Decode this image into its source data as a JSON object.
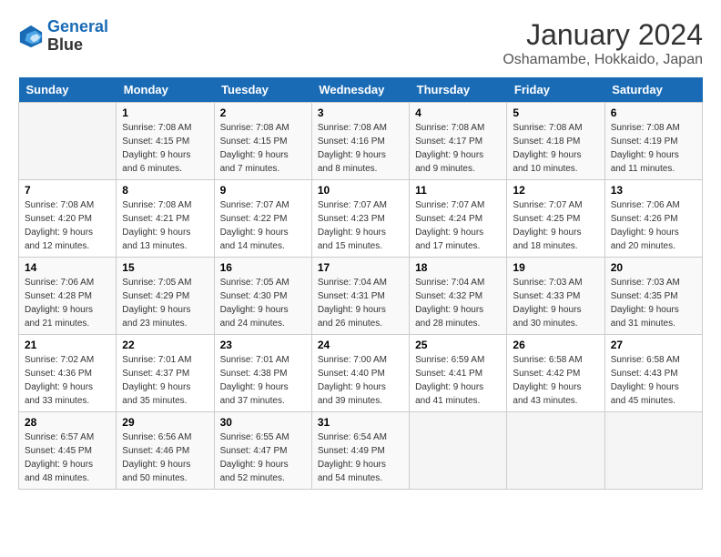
{
  "header": {
    "logo_line1": "General",
    "logo_line2": "Blue",
    "title": "January 2024",
    "subtitle": "Oshamambe, Hokkaido, Japan"
  },
  "days_of_week": [
    "Sunday",
    "Monday",
    "Tuesday",
    "Wednesday",
    "Thursday",
    "Friday",
    "Saturday"
  ],
  "weeks": [
    [
      {
        "num": "",
        "detail": ""
      },
      {
        "num": "1",
        "detail": "Sunrise: 7:08 AM\nSunset: 4:15 PM\nDaylight: 9 hours\nand 6 minutes."
      },
      {
        "num": "2",
        "detail": "Sunrise: 7:08 AM\nSunset: 4:15 PM\nDaylight: 9 hours\nand 7 minutes."
      },
      {
        "num": "3",
        "detail": "Sunrise: 7:08 AM\nSunset: 4:16 PM\nDaylight: 9 hours\nand 8 minutes."
      },
      {
        "num": "4",
        "detail": "Sunrise: 7:08 AM\nSunset: 4:17 PM\nDaylight: 9 hours\nand 9 minutes."
      },
      {
        "num": "5",
        "detail": "Sunrise: 7:08 AM\nSunset: 4:18 PM\nDaylight: 9 hours\nand 10 minutes."
      },
      {
        "num": "6",
        "detail": "Sunrise: 7:08 AM\nSunset: 4:19 PM\nDaylight: 9 hours\nand 11 minutes."
      }
    ],
    [
      {
        "num": "7",
        "detail": "Sunrise: 7:08 AM\nSunset: 4:20 PM\nDaylight: 9 hours\nand 12 minutes."
      },
      {
        "num": "8",
        "detail": "Sunrise: 7:08 AM\nSunset: 4:21 PM\nDaylight: 9 hours\nand 13 minutes."
      },
      {
        "num": "9",
        "detail": "Sunrise: 7:07 AM\nSunset: 4:22 PM\nDaylight: 9 hours\nand 14 minutes."
      },
      {
        "num": "10",
        "detail": "Sunrise: 7:07 AM\nSunset: 4:23 PM\nDaylight: 9 hours\nand 15 minutes."
      },
      {
        "num": "11",
        "detail": "Sunrise: 7:07 AM\nSunset: 4:24 PM\nDaylight: 9 hours\nand 17 minutes."
      },
      {
        "num": "12",
        "detail": "Sunrise: 7:07 AM\nSunset: 4:25 PM\nDaylight: 9 hours\nand 18 minutes."
      },
      {
        "num": "13",
        "detail": "Sunrise: 7:06 AM\nSunset: 4:26 PM\nDaylight: 9 hours\nand 20 minutes."
      }
    ],
    [
      {
        "num": "14",
        "detail": "Sunrise: 7:06 AM\nSunset: 4:28 PM\nDaylight: 9 hours\nand 21 minutes."
      },
      {
        "num": "15",
        "detail": "Sunrise: 7:05 AM\nSunset: 4:29 PM\nDaylight: 9 hours\nand 23 minutes."
      },
      {
        "num": "16",
        "detail": "Sunrise: 7:05 AM\nSunset: 4:30 PM\nDaylight: 9 hours\nand 24 minutes."
      },
      {
        "num": "17",
        "detail": "Sunrise: 7:04 AM\nSunset: 4:31 PM\nDaylight: 9 hours\nand 26 minutes."
      },
      {
        "num": "18",
        "detail": "Sunrise: 7:04 AM\nSunset: 4:32 PM\nDaylight: 9 hours\nand 28 minutes."
      },
      {
        "num": "19",
        "detail": "Sunrise: 7:03 AM\nSunset: 4:33 PM\nDaylight: 9 hours\nand 30 minutes."
      },
      {
        "num": "20",
        "detail": "Sunrise: 7:03 AM\nSunset: 4:35 PM\nDaylight: 9 hours\nand 31 minutes."
      }
    ],
    [
      {
        "num": "21",
        "detail": "Sunrise: 7:02 AM\nSunset: 4:36 PM\nDaylight: 9 hours\nand 33 minutes."
      },
      {
        "num": "22",
        "detail": "Sunrise: 7:01 AM\nSunset: 4:37 PM\nDaylight: 9 hours\nand 35 minutes."
      },
      {
        "num": "23",
        "detail": "Sunrise: 7:01 AM\nSunset: 4:38 PM\nDaylight: 9 hours\nand 37 minutes."
      },
      {
        "num": "24",
        "detail": "Sunrise: 7:00 AM\nSunset: 4:40 PM\nDaylight: 9 hours\nand 39 minutes."
      },
      {
        "num": "25",
        "detail": "Sunrise: 6:59 AM\nSunset: 4:41 PM\nDaylight: 9 hours\nand 41 minutes."
      },
      {
        "num": "26",
        "detail": "Sunrise: 6:58 AM\nSunset: 4:42 PM\nDaylight: 9 hours\nand 43 minutes."
      },
      {
        "num": "27",
        "detail": "Sunrise: 6:58 AM\nSunset: 4:43 PM\nDaylight: 9 hours\nand 45 minutes."
      }
    ],
    [
      {
        "num": "28",
        "detail": "Sunrise: 6:57 AM\nSunset: 4:45 PM\nDaylight: 9 hours\nand 48 minutes."
      },
      {
        "num": "29",
        "detail": "Sunrise: 6:56 AM\nSunset: 4:46 PM\nDaylight: 9 hours\nand 50 minutes."
      },
      {
        "num": "30",
        "detail": "Sunrise: 6:55 AM\nSunset: 4:47 PM\nDaylight: 9 hours\nand 52 minutes."
      },
      {
        "num": "31",
        "detail": "Sunrise: 6:54 AM\nSunset: 4:49 PM\nDaylight: 9 hours\nand 54 minutes."
      },
      {
        "num": "",
        "detail": ""
      },
      {
        "num": "",
        "detail": ""
      },
      {
        "num": "",
        "detail": ""
      }
    ]
  ]
}
